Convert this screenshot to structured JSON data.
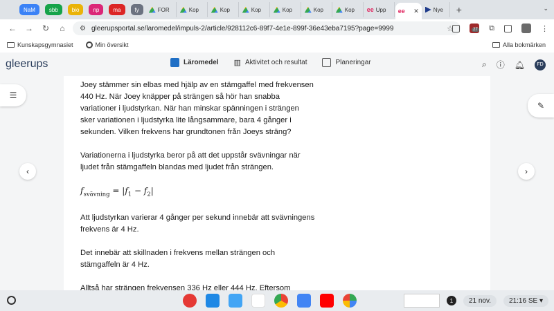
{
  "tabs": {
    "pills": [
      {
        "label": "NaM",
        "color": "#3b82f6"
      },
      {
        "label": "sbb",
        "color": "#16a34a"
      },
      {
        "label": "bio",
        "color": "#eab308"
      },
      {
        "label": "np",
        "color": "#db2777"
      },
      {
        "label": "ma",
        "color": "#dc2626"
      }
    ],
    "fy": "fy",
    "drive_tabs": [
      "FOR",
      "Kop",
      "Kop",
      "Kop",
      "Kop",
      "Kop",
      "Kop"
    ],
    "upp_tab": "Upp",
    "active_tab_icon": "ee",
    "last_tab": "Nye"
  },
  "address": {
    "url": "gleerupsportal.se/laromedel/impuls-2/article/928112c6-89f7-4e1e-899f-36e43eba7195?page=9999",
    "ext_badge": "27"
  },
  "bookmarks": {
    "items": [
      "Kunskapsgymnasiet",
      "Min översikt"
    ],
    "all": "Alla bokmärken"
  },
  "app": {
    "logo": "gleerups",
    "nav": [
      "Läromedel",
      "Aktivitet och resultat",
      "Planeringar"
    ],
    "avatar": "FD"
  },
  "article": {
    "p1": "Joey stämmer sin elbas med hjälp av en stämgaffel med frekvensen 440 Hz. När Joey knäpper på strängen så hör han snabba variationer i ljudstyrkan. När han minskar spänningen i strängen sker variationen i ljudstyrka lite långsammare, bara 4 gånger i sekunden. Vilken frekvens har grundtonen från Joeys sträng?",
    "p2": "Variationerna i ljudstyrka beror på att det uppstår svävningar när ljudet från stämgaffeln blandas med ljudet från strängen.",
    "formula": {
      "f": "f",
      "sub": "svävning",
      "eq": " = |",
      "f1": "f",
      "s1": "1",
      "minus": " − ",
      "f2": "f",
      "s2": "2",
      "end": "|"
    },
    "p3": "Att ljudstyrkan varierar 4 gånger per sekund innebär att svävningens frekvens är 4 Hz.",
    "p4": "Det innebär att skillnaden i frekvens mellan strängen och stämgaffeln är 4 Hz.",
    "p5": "Alltså har strängen frekvensen 336 Hz eller 444 Hz. Eftersom svävningarnas frekvens minskar när Joey minskar spännkraften i"
  },
  "shelf": {
    "notif_count": "1",
    "date": "21 nov.",
    "time": "21:16",
    "locale": "SE",
    "app_colors": [
      "#e53935",
      "#1e88e5",
      "#42a5f5",
      "#ffffff",
      "#4caf50",
      "#4285f4",
      "#ff0000",
      "#34a853"
    ]
  }
}
